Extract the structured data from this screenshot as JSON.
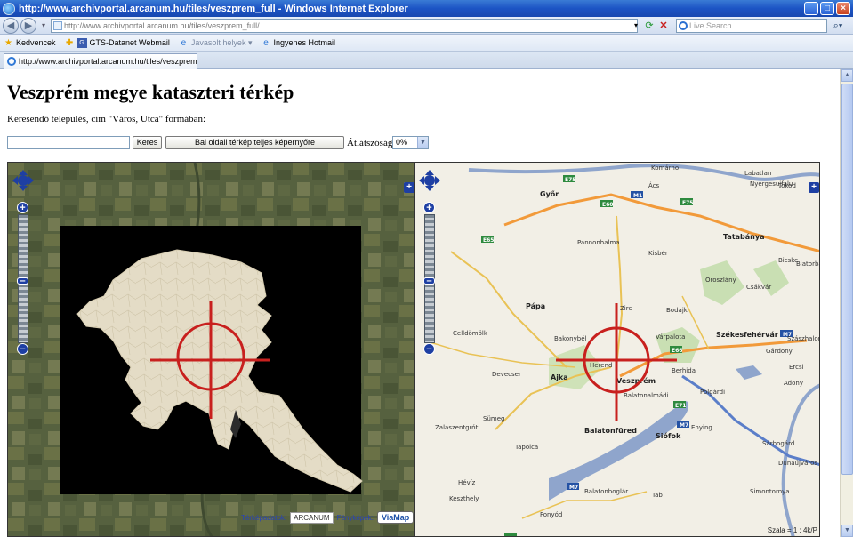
{
  "window": {
    "title": "http://www.archivportal.arcanum.hu/tiles/veszprem_full - Windows Internet Explorer",
    "controls": [
      "_",
      "□",
      "×"
    ]
  },
  "addressbar": {
    "url": "http://www.archivportal.arcanum.hu/tiles/veszprem_full/",
    "search_placeholder": "Live Search"
  },
  "favorites": {
    "items": [
      {
        "label": "Kedvencek",
        "icon": "star-icon"
      },
      {
        "label": "GTS-Datanet Webmail",
        "icon": "mail-icon"
      },
      {
        "label": "Javasolt helyek ▾",
        "icon": "ie-icon",
        "disabled": true
      },
      {
        "label": "Ingyenes Hotmail",
        "icon": "ie-icon"
      }
    ]
  },
  "tab": {
    "label": "http://www.archivportal.arcanum.hu/tiles/veszprem_full"
  },
  "page": {
    "title": "Veszprém megye kataszteri térkép",
    "instructions": "Keresendő település, cím \"Város, Utca\" formában:",
    "search_value": "",
    "search_button": "Keres",
    "fullscreen_button": "Bal oldali térkép teljes képernyőre",
    "opacity_label": "Átlátszóság:",
    "opacity_value": "0%"
  },
  "left_map": {
    "credits_label_1": "Térképadatok:",
    "logo_1": "ARCANUM",
    "credits_label_2": "Fényképek:",
    "logo_2": "ViaMap"
  },
  "right_map": {
    "scale": "Szala = 1 : 4k/P",
    "places": [
      "Komárno",
      "Labatlan",
      "Nyergesujfalu",
      "Tokod",
      "Győr",
      "Ács",
      "Kisbér",
      "Tatabánya",
      "Bicske",
      "Biatorbágy",
      "Oroszlány",
      "Csákvár",
      "Pannonhalma",
      "Pápa",
      "Zirc",
      "Bodajk",
      "Várpalota",
      "Székesfehérvár",
      "Gárdony",
      "Ajka",
      "Veszprém",
      "Herend",
      "Balatonfüred",
      "Balatonalmádi",
      "Siófok",
      "Enying",
      "Celldömölk",
      "Devecser",
      "Sümeg",
      "Tapolca",
      "Hévíz",
      "Keszthely",
      "Fonyód",
      "Balatonboglár",
      "Zalaszentgrót",
      "Polgárdi",
      "Sárbogárd",
      "Ercsi",
      "Szászhalombatta",
      "Dunaújváros",
      "Simontornya",
      "Tab",
      "Bakonybél",
      "Berhida",
      "Adony"
    ]
  },
  "colors": {
    "crosshair": "#c8201e",
    "titlebar": "#1c54c4",
    "zoom_control": "#1e3fa3",
    "lake": "#8fa5cc"
  }
}
